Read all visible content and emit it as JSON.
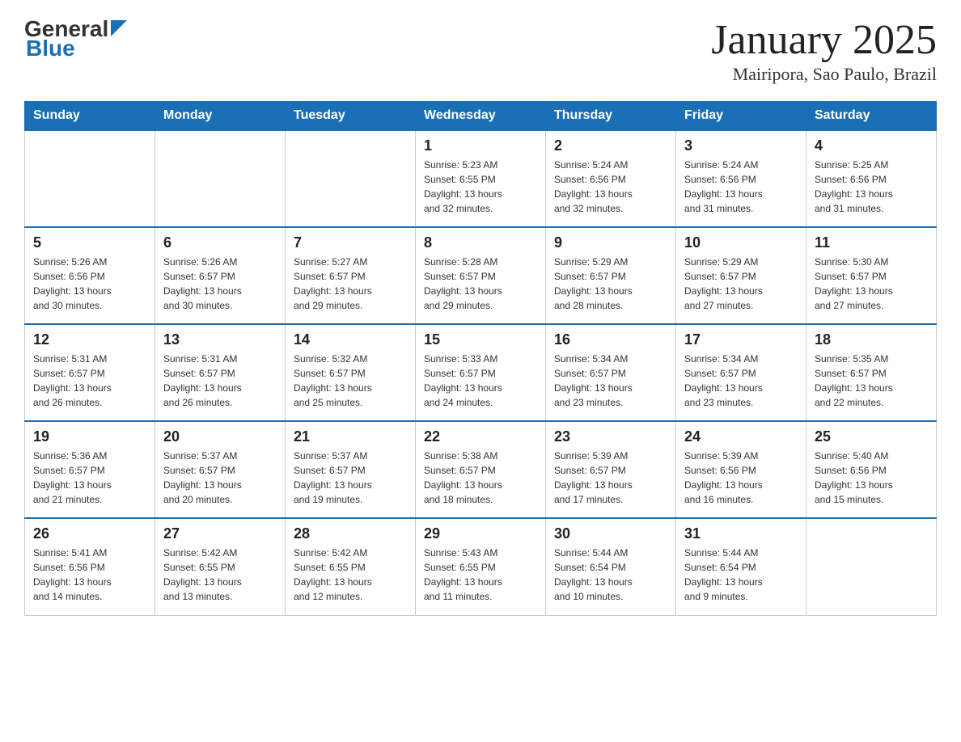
{
  "header": {
    "logo_general": "General",
    "logo_blue": "Blue",
    "title": "January 2025",
    "subtitle": "Mairipora, Sao Paulo, Brazil"
  },
  "columns": [
    "Sunday",
    "Monday",
    "Tuesday",
    "Wednesday",
    "Thursday",
    "Friday",
    "Saturday"
  ],
  "weeks": [
    [
      {
        "day": "",
        "info": ""
      },
      {
        "day": "",
        "info": ""
      },
      {
        "day": "",
        "info": ""
      },
      {
        "day": "1",
        "info": "Sunrise: 5:23 AM\nSunset: 6:55 PM\nDaylight: 13 hours\nand 32 minutes."
      },
      {
        "day": "2",
        "info": "Sunrise: 5:24 AM\nSunset: 6:56 PM\nDaylight: 13 hours\nand 32 minutes."
      },
      {
        "day": "3",
        "info": "Sunrise: 5:24 AM\nSunset: 6:56 PM\nDaylight: 13 hours\nand 31 minutes."
      },
      {
        "day": "4",
        "info": "Sunrise: 5:25 AM\nSunset: 6:56 PM\nDaylight: 13 hours\nand 31 minutes."
      }
    ],
    [
      {
        "day": "5",
        "info": "Sunrise: 5:26 AM\nSunset: 6:56 PM\nDaylight: 13 hours\nand 30 minutes."
      },
      {
        "day": "6",
        "info": "Sunrise: 5:26 AM\nSunset: 6:57 PM\nDaylight: 13 hours\nand 30 minutes."
      },
      {
        "day": "7",
        "info": "Sunrise: 5:27 AM\nSunset: 6:57 PM\nDaylight: 13 hours\nand 29 minutes."
      },
      {
        "day": "8",
        "info": "Sunrise: 5:28 AM\nSunset: 6:57 PM\nDaylight: 13 hours\nand 29 minutes."
      },
      {
        "day": "9",
        "info": "Sunrise: 5:29 AM\nSunset: 6:57 PM\nDaylight: 13 hours\nand 28 minutes."
      },
      {
        "day": "10",
        "info": "Sunrise: 5:29 AM\nSunset: 6:57 PM\nDaylight: 13 hours\nand 27 minutes."
      },
      {
        "day": "11",
        "info": "Sunrise: 5:30 AM\nSunset: 6:57 PM\nDaylight: 13 hours\nand 27 minutes."
      }
    ],
    [
      {
        "day": "12",
        "info": "Sunrise: 5:31 AM\nSunset: 6:57 PM\nDaylight: 13 hours\nand 26 minutes."
      },
      {
        "day": "13",
        "info": "Sunrise: 5:31 AM\nSunset: 6:57 PM\nDaylight: 13 hours\nand 26 minutes."
      },
      {
        "day": "14",
        "info": "Sunrise: 5:32 AM\nSunset: 6:57 PM\nDaylight: 13 hours\nand 25 minutes."
      },
      {
        "day": "15",
        "info": "Sunrise: 5:33 AM\nSunset: 6:57 PM\nDaylight: 13 hours\nand 24 minutes."
      },
      {
        "day": "16",
        "info": "Sunrise: 5:34 AM\nSunset: 6:57 PM\nDaylight: 13 hours\nand 23 minutes."
      },
      {
        "day": "17",
        "info": "Sunrise: 5:34 AM\nSunset: 6:57 PM\nDaylight: 13 hours\nand 23 minutes."
      },
      {
        "day": "18",
        "info": "Sunrise: 5:35 AM\nSunset: 6:57 PM\nDaylight: 13 hours\nand 22 minutes."
      }
    ],
    [
      {
        "day": "19",
        "info": "Sunrise: 5:36 AM\nSunset: 6:57 PM\nDaylight: 13 hours\nand 21 minutes."
      },
      {
        "day": "20",
        "info": "Sunrise: 5:37 AM\nSunset: 6:57 PM\nDaylight: 13 hours\nand 20 minutes."
      },
      {
        "day": "21",
        "info": "Sunrise: 5:37 AM\nSunset: 6:57 PM\nDaylight: 13 hours\nand 19 minutes."
      },
      {
        "day": "22",
        "info": "Sunrise: 5:38 AM\nSunset: 6:57 PM\nDaylight: 13 hours\nand 18 minutes."
      },
      {
        "day": "23",
        "info": "Sunrise: 5:39 AM\nSunset: 6:57 PM\nDaylight: 13 hours\nand 17 minutes."
      },
      {
        "day": "24",
        "info": "Sunrise: 5:39 AM\nSunset: 6:56 PM\nDaylight: 13 hours\nand 16 minutes."
      },
      {
        "day": "25",
        "info": "Sunrise: 5:40 AM\nSunset: 6:56 PM\nDaylight: 13 hours\nand 15 minutes."
      }
    ],
    [
      {
        "day": "26",
        "info": "Sunrise: 5:41 AM\nSunset: 6:56 PM\nDaylight: 13 hours\nand 14 minutes."
      },
      {
        "day": "27",
        "info": "Sunrise: 5:42 AM\nSunset: 6:55 PM\nDaylight: 13 hours\nand 13 minutes."
      },
      {
        "day": "28",
        "info": "Sunrise: 5:42 AM\nSunset: 6:55 PM\nDaylight: 13 hours\nand 12 minutes."
      },
      {
        "day": "29",
        "info": "Sunrise: 5:43 AM\nSunset: 6:55 PM\nDaylight: 13 hours\nand 11 minutes."
      },
      {
        "day": "30",
        "info": "Sunrise: 5:44 AM\nSunset: 6:54 PM\nDaylight: 13 hours\nand 10 minutes."
      },
      {
        "day": "31",
        "info": "Sunrise: 5:44 AM\nSunset: 6:54 PM\nDaylight: 13 hours\nand 9 minutes."
      },
      {
        "day": "",
        "info": ""
      }
    ]
  ]
}
